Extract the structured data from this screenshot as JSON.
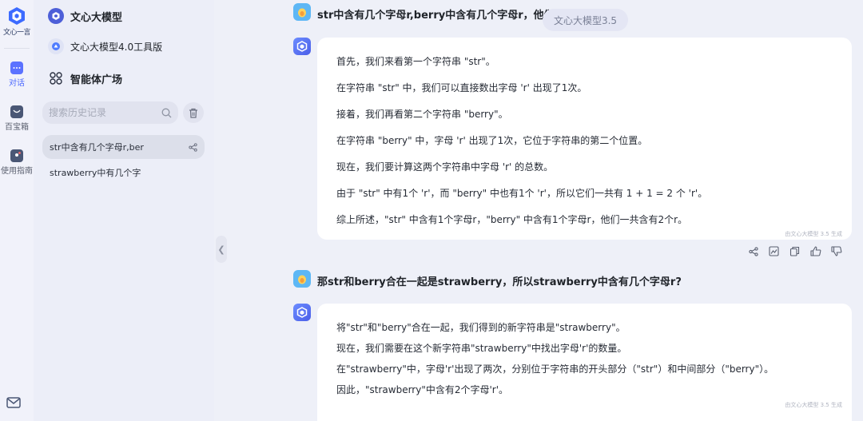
{
  "rail": {
    "logo_text": "文心一言",
    "items": [
      {
        "label": "对话",
        "icon": "chat-icon"
      },
      {
        "label": "百宝箱",
        "icon": "toolbox-icon"
      },
      {
        "label": "使用指南",
        "icon": "guide-icon"
      }
    ],
    "mail_icon": "mail-icon"
  },
  "sidebar": {
    "model_title": "文心大模型",
    "model_tool": "文心大模型4.0工具版",
    "agent_plaza": "智能体广场",
    "search_placeholder": "搜索历史记录",
    "history": [
      "str中含有几个字母r,ber",
      "strawberry中有几个字"
    ]
  },
  "tooltip": "文心大模型3.5",
  "conversation": {
    "q1": "str中含有几个字母r,berry中含有几个字母r，他们一共",
    "a1": [
      "首先，我们来看第一个字符串 \"str\"。",
      "在字符串 \"str\" 中，我们可以直接数出字母 'r' 出现了1次。",
      "接着，我们再看第二个字符串 \"berry\"。",
      "在字符串 \"berry\" 中，字母 'r' 出现了1次，它位于字符串的第二个位置。",
      "现在，我们要计算这两个字符串中字母 'r' 的总数。",
      "由于 \"str\" 中有1个 'r'，而 \"berry\" 中也有1个 'r'，所以它们一共有 1 + 1 = 2 个 'r'。",
      "综上所述，\"str\" 中含有1个字母r，\"berry\" 中含有1个字母r，他们一共含有2个r。"
    ],
    "a1_generated_by": "由文心大模型 3.5 生成",
    "q2": "那str和berry合在一起是strawberry，所以strawberry中含有几个字母r?",
    "a2": [
      "将\"str\"和\"berry\"合在一起，我们得到的新字符串是\"strawberry\"。",
      "现在，我们需要在这个新字符串\"strawberry\"中找出字母'r'的数量。",
      "在\"strawberry\"中，字母'r'出现了两次，分别位于字符串的开头部分（\"str\"）和中间部分（\"berry\"）。",
      "因此，\"strawberry\"中含有2个字母'r'。"
    ],
    "a2_generated_by": "由文心大模型 3.5 生成"
  },
  "actions": [
    "share-icon",
    "image-icon",
    "copy-icon",
    "thumbs-up-icon",
    "thumbs-down-icon"
  ],
  "colors": {
    "accent": "#4f6bff",
    "bubble": "#ffffff",
    "background": "#eef0f8"
  }
}
